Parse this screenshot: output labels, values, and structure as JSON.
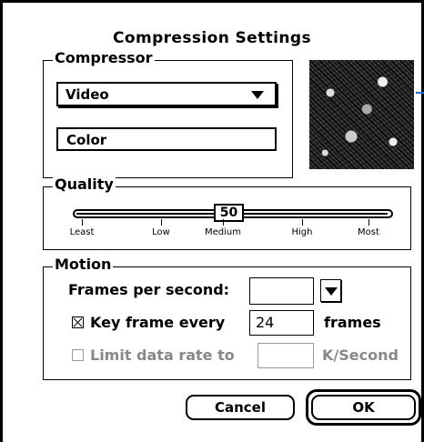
{
  "dialog": {
    "title": "Compression Settings"
  },
  "compressor": {
    "group_label": "Compressor",
    "type_value": "Video",
    "depth_value": "Color"
  },
  "quality": {
    "group_label": "Quality",
    "value": "50",
    "value_fraction": 0.5,
    "ticks": [
      "Least",
      "Low",
      "Medium",
      "High",
      "Most"
    ]
  },
  "motion": {
    "group_label": "Motion",
    "fps_label": "Frames per second:",
    "fps_value": "",
    "keyframe_checked": true,
    "keyframe_label": "Key frame every",
    "keyframe_value": "24",
    "keyframe_unit": "frames",
    "datarate_checked": false,
    "datarate_label": "Limit data rate to",
    "datarate_value": "",
    "datarate_unit": "K/Second"
  },
  "buttons": {
    "cancel": "Cancel",
    "ok": "OK"
  },
  "icons": {
    "popup_arrow": "triangle-down-icon",
    "checkbox_checked": "x-mark-icon"
  }
}
